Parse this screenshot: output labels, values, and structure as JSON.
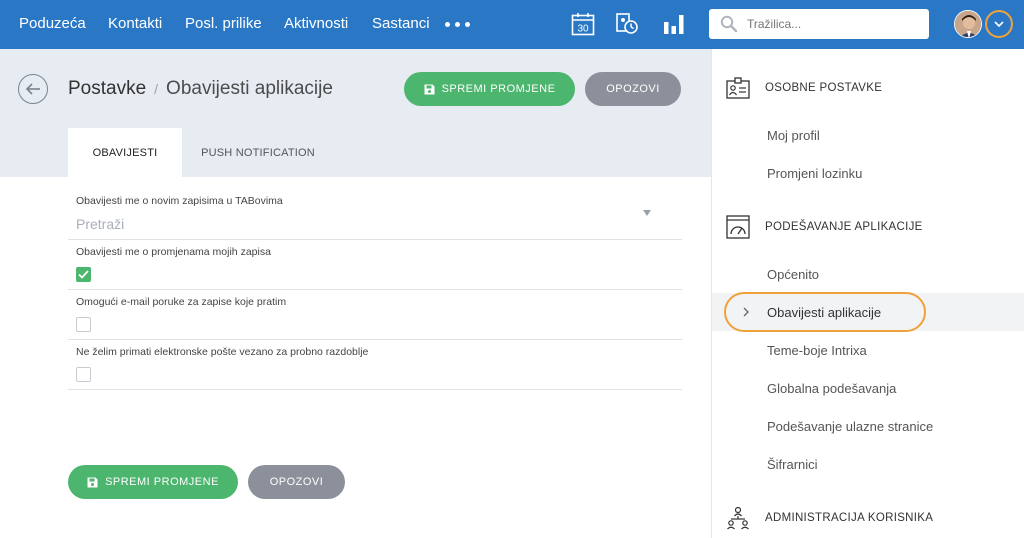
{
  "topnav": {
    "items": [
      "Poduzeća",
      "Kontakti",
      "Posl. prilike",
      "Aktivnosti",
      "Sastanci"
    ],
    "calendar_day": "30",
    "search_placeholder": "Tražilica..."
  },
  "header": {
    "breadcrumb_root": "Postavke",
    "breadcrumb_separator": "/",
    "page_title": "Obavijesti aplikacije",
    "save_label": "SPREMI PROMJENE",
    "cancel_label": "OPOZOVI"
  },
  "tabs": [
    {
      "label": "OBAVIJESTI",
      "active": true
    },
    {
      "label": "PUSH NOTIFICATION",
      "active": false
    }
  ],
  "form": {
    "fields": [
      {
        "label": "Obavijesti me o novim zapisima u TABovima",
        "type": "select",
        "placeholder": "Pretraži"
      },
      {
        "label": "Obavijesti me o promjenama mojih zapisa",
        "type": "checkbox",
        "checked": true
      },
      {
        "label": "Omogući e-mail poruke za zapise koje pratim",
        "type": "checkbox",
        "checked": false
      },
      {
        "label": "Ne želim primati elektronske pošte vezano za probno razdoblje",
        "type": "checkbox",
        "checked": false
      }
    ]
  },
  "footer": {
    "save_label": "SPREMI PROMJENE",
    "cancel_label": "OPOZOVI"
  },
  "sidebar": {
    "sections": [
      {
        "title": "OSOBNE POSTAVKE",
        "icon": "id-card-icon",
        "items": [
          "Moj profil",
          "Promjeni lozinku"
        ]
      },
      {
        "title": "PODEŠAVANJE APLIKACIJE",
        "icon": "gauge-icon",
        "items": [
          "Općenito",
          "Obavijesti aplikacije",
          "Teme-boje Intrixa",
          "Globalna podešavanja",
          "Podešavanje ulazne stranice",
          "Šifrarnici"
        ]
      },
      {
        "title": "ADMINISTRACIJA KORISNIKA",
        "icon": "users-hierarchy-icon",
        "items": []
      }
    ],
    "active_item": "Obavijesti aplikacije"
  },
  "colors": {
    "topbar": "#2a78c5",
    "save": "#4cb56e",
    "cancel": "#8b909a",
    "highlight": "#f0a13a",
    "header_bg": "#e7ebf2"
  }
}
